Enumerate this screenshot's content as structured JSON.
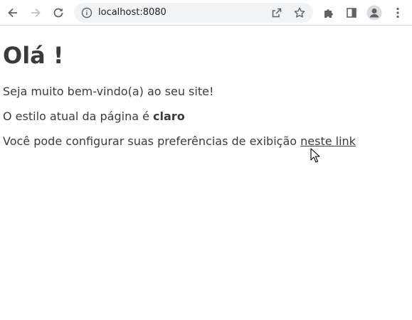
{
  "browser": {
    "url": "localhost:8080"
  },
  "page": {
    "title": "Olá !",
    "welcome": "Seja muito bem-vindo(a) ao seu site!",
    "style_prefix": "O estilo atual da página é ",
    "style_value": "claro",
    "prefs_text": "Você pode configurar suas preferências de exibição ",
    "prefs_link": "neste link"
  }
}
